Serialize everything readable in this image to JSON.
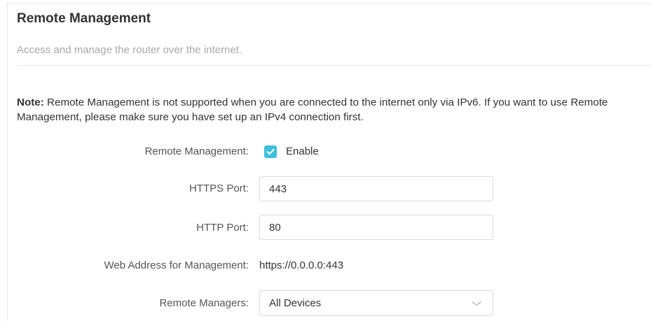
{
  "section": {
    "title": "Remote Management",
    "subtitle": "Access and manage the router over the internet."
  },
  "note": {
    "label": "Note:",
    "text": " Remote Management is not supported when you are connected to the internet only via IPv6. If you want to use Remote Management, please make sure you have set up an IPv4 connection first."
  },
  "form": {
    "remote_management": {
      "label": "Remote Management:",
      "checkbox_label": "Enable",
      "checked": true
    },
    "https_port": {
      "label": "HTTPS Port:",
      "value": "443"
    },
    "http_port": {
      "label": "HTTP Port:",
      "value": "80"
    },
    "web_address": {
      "label": "Web Address for Management:",
      "value": "https://0.0.0.0:443"
    },
    "remote_managers": {
      "label": "Remote Managers:",
      "selected": "All Devices"
    }
  },
  "colors": {
    "accent": "#3ebfd9",
    "border": "#d9d9d9",
    "muted_text": "#a7a7a7"
  },
  "icons": {
    "checkbox": "checkmark-icon",
    "dropdown": "chevron-down-icon"
  }
}
